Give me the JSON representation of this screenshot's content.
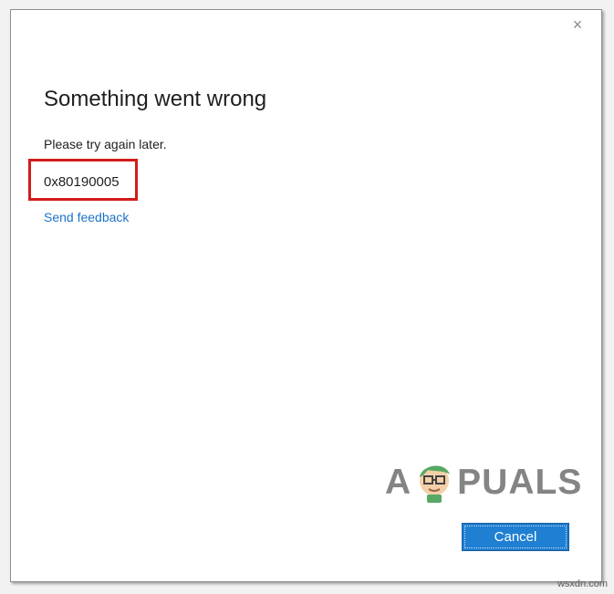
{
  "dialog": {
    "close_label": "×",
    "title": "Something went wrong",
    "message": "Please try again later.",
    "error_code": "0x80190005",
    "feedback_link": "Send feedback",
    "cancel_label": "Cancel"
  },
  "watermark": {
    "prefix": "A",
    "suffix": "PUALS"
  },
  "corner_mark": "wsxdn.com",
  "colors": {
    "dialog_background": "#ffffff",
    "accent_blue": "#1f7fd2",
    "link_blue": "#1c73c8",
    "highlight_red": "#d21b1b",
    "mascot_green": "#3a9a4a"
  }
}
